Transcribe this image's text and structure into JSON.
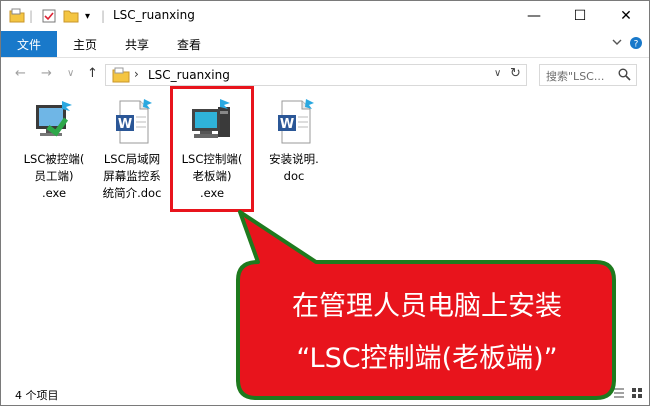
{
  "window": {
    "title": "LSC_ruanxing",
    "controls": {
      "minimize": "—",
      "maximize": "☐",
      "close": "✕"
    }
  },
  "ribbon": {
    "tabs": [
      "文件",
      "主页",
      "共享",
      "查看"
    ],
    "expand_icon": "chevron-down",
    "help_icon": "question"
  },
  "navigation": {
    "back": "←",
    "forward": "→",
    "recent": "∨",
    "up": "↑",
    "breadcrumb_separator": "›",
    "address": "LSC_ruanxing",
    "address_dropdown": "∨",
    "refresh": "↻",
    "search_placeholder": "搜索\"LSC...",
    "search_icon": "magnifier"
  },
  "files": [
    {
      "label_lines": [
        "LSC被控端(",
        "员工端)",
        ".exe"
      ],
      "icon": "monitor-program-icon"
    },
    {
      "label_lines": [
        "LSC局域网",
        "屏幕监控系",
        "统简介.doc"
      ],
      "icon": "word-document-icon"
    },
    {
      "label_lines": [
        "LSC控制端(",
        "老板端)",
        ".exe"
      ],
      "icon": "computer-program-icon"
    },
    {
      "label_lines": [
        "安装说明.",
        "doc"
      ],
      "icon": "word-document-icon"
    }
  ],
  "status": {
    "item_count": "4 个项目"
  },
  "callout": {
    "line1": "在管理人员电脑上安装",
    "line2": "“LSC控制端(老板端)”",
    "fill": "#e8141c",
    "border": "#1e7a1e"
  }
}
